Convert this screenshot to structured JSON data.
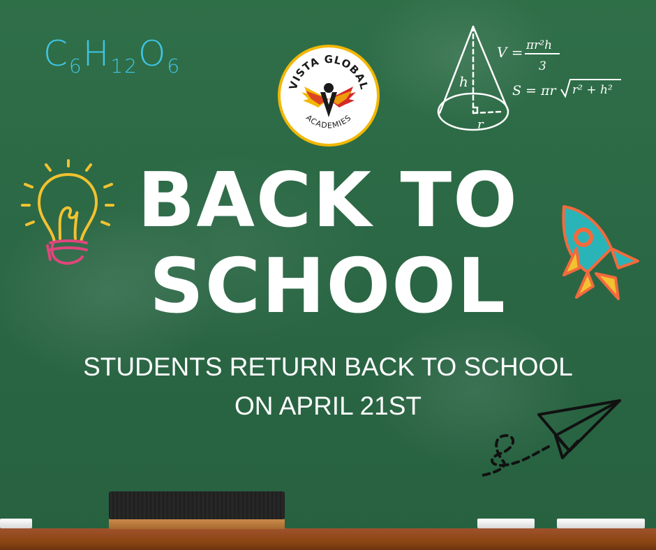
{
  "formula": {
    "c": "C",
    "c_sub": "6",
    "h": "H",
    "h_sub": "12",
    "o": "O",
    "o_sub": "6"
  },
  "logo": {
    "top_text": "VISTA GLOBAL",
    "bottom_text": "ACADEMIES",
    "letter": "V"
  },
  "math": {
    "volume": "V = πr²h / 3",
    "surface": "S = πr√(r² + h²)",
    "h_label": "h",
    "r_label": "r",
    "v_prefix": "V =",
    "v_num": "πr²h",
    "v_den": "3",
    "s_prefix": "S = πr",
    "s_root": "r² + h²"
  },
  "headline": {
    "line1": "BACK TO",
    "line2": "SCHOOL"
  },
  "subtitle": {
    "line1": "STUDENTS RETURN BACK TO SCHOOL",
    "line2": "ON APRIL 21ST"
  },
  "colors": {
    "board": "#2c6a45",
    "formula": "#3fc6e6",
    "bulb": "#f2c230",
    "bulb_base": "#e0457b",
    "rocket_body": "#f26a3d",
    "rocket_window": "#2bb4b8",
    "rocket_fin": "#f2c230",
    "logo_red": "#d62828",
    "logo_yellow": "#f2b705",
    "ledge": "#8b4513"
  },
  "icons": [
    "lightbulb-icon",
    "rocket-icon",
    "paper-plane-icon",
    "cone-icon",
    "eraser-icon",
    "chalk-icon"
  ]
}
